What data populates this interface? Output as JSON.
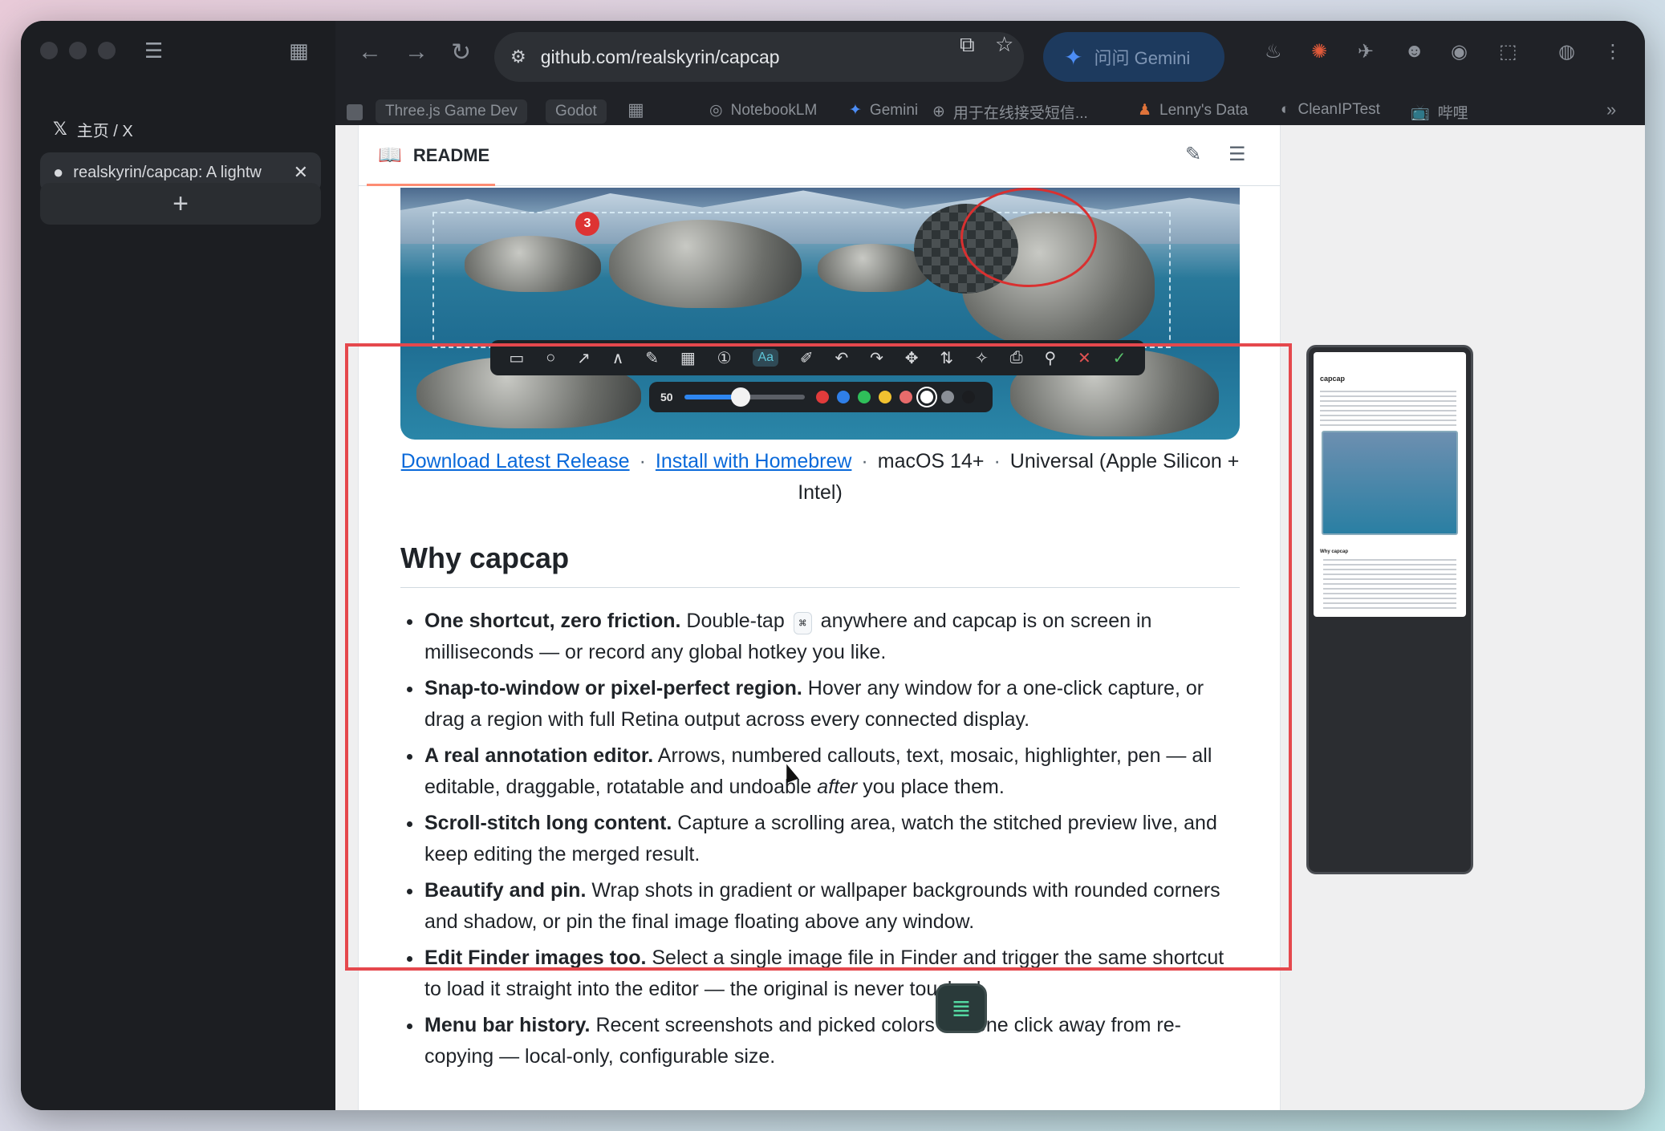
{
  "sidebar": {
    "tabs": [
      {
        "label": "主页 / X",
        "icon": "x-logo-icon"
      },
      {
        "label": "realskyrin/capcap: A lightw",
        "icon": "github-icon",
        "active": true
      }
    ],
    "new_tab_label": "+"
  },
  "toolbar": {
    "url": "github.com/realskyrin/capcap",
    "gemini_label": "问问 Gemini"
  },
  "bookmarks": [
    {
      "label": "Three.js Game Dev",
      "chip": true
    },
    {
      "label": "Godot",
      "chip": true
    },
    {
      "label": "NotebookLM"
    },
    {
      "label": "Gemini"
    },
    {
      "label": "用于在线接受短信..."
    },
    {
      "label": "Lenny's Data"
    },
    {
      "label": "CleanIPTest"
    },
    {
      "label": "哔哩"
    }
  ],
  "readme": {
    "header_label": "README",
    "hero": {
      "callout_number": "3",
      "stroke_size": "50",
      "text_tool_label": "Aa",
      "palette": [
        "#e03b3b",
        "#2f7fe8",
        "#2fbf5a",
        "#f2c230",
        "#e86b6b",
        "#ffffff",
        "#8a8f96",
        "#1b1d20"
      ]
    },
    "links": {
      "download": "Download Latest Release",
      "homebrew": "Install with Homebrew",
      "sep": "·",
      "macos": "macOS 14+",
      "universal": "Universal (Apple Silicon + Intel)"
    },
    "why_heading": "Why capcap",
    "features": [
      {
        "title": "One shortcut, zero friction.",
        "pre": " Double-tap ",
        "kbd": "⌘",
        "post": " anywhere and capcap is on screen in milliseconds — or record any global hotkey you like."
      },
      {
        "title": "Snap-to-window or pixel-perfect region.",
        "pre": " Hover any window for a one-click capture, or drag a region with full Retina output across every connected display.",
        "kbd": "",
        "post": ""
      },
      {
        "title": "A real annotation editor.",
        "pre": " Arrows, numbered callouts, text, mosaic, highlighter, pen — all editable, draggable, rotatable and undoable ",
        "em": "after",
        "post": " you place them."
      },
      {
        "title": "Scroll-stitch long content.",
        "pre": " Capture a scrolling area, watch the stitched preview live, and keep editing the merged result.",
        "kbd": "",
        "post": ""
      },
      {
        "title": "Beautify and pin.",
        "pre": " Wrap shots in gradient or wallpaper backgrounds with rounded corners and shadow, or pin the final image floating above any window.",
        "kbd": "",
        "post": ""
      },
      {
        "title": "Edit Finder images too.",
        "pre": " Select a single image file in Finder and trigger the same shortcut to load it straight into the editor — the original is never touched.",
        "kbd": "",
        "post": ""
      },
      {
        "title": "Menu bar history.",
        "pre": " Recent screenshots and picked colors are one click away from re-copying — local-only, configurable size.",
        "kbd": "",
        "post": ""
      }
    ]
  },
  "preview_thumb": {
    "title": "capcap",
    "heading": "Why capcap"
  },
  "colors": {
    "selection_frame": "#e5484d",
    "link": "#0969da",
    "window_bg": "#1c1e22"
  }
}
